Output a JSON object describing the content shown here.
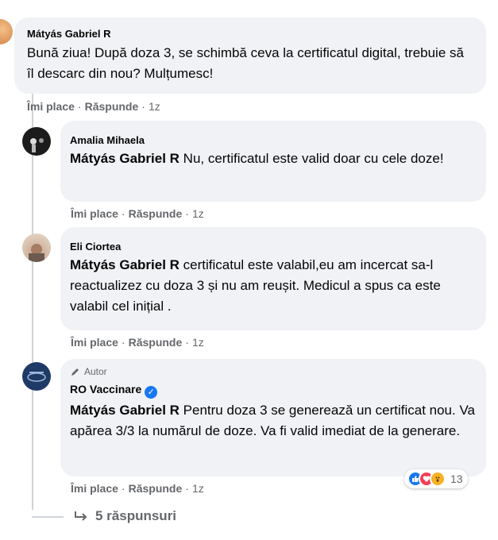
{
  "comments": [
    {
      "author": "Mátyás Gabriel R",
      "text": "Bună ziua! După doza 3, se schimbă ceva la certificatul digital, trebuie să îl descarc din nou? Mulțumesc!",
      "actions": {
        "like": "Îmi place",
        "reply": "Răspunde",
        "time": "1z"
      }
    },
    {
      "author": "Amalia Mihaela",
      "mention": "Mátyás Gabriel R",
      "text": " Nu, certificatul este valid doar cu cele doze!",
      "actions": {
        "like": "Îmi place",
        "reply": "Răspunde",
        "time": "1z"
      }
    },
    {
      "author": "Eli Ciortea",
      "mention": "Mátyás Gabriel R",
      "text": " certificatul este valabil,eu am incercat sa-l reactualizez cu doza 3 și nu am reușit. Medicul a spus ca este valabil cel inițial .",
      "actions": {
        "like": "Îmi place",
        "reply": "Răspunde",
        "time": "1z"
      }
    },
    {
      "author_tag": "Autor",
      "author": "RO Vaccinare",
      "mention": "Mátyás Gabriel R",
      "text": " Pentru doza 3 se generează un certificat nou. Va apărea 3/3 la numărul de doze. Va fi valid imediat de la generare.",
      "actions": {
        "like": "Îmi place",
        "reply": "Răspunde",
        "time": "1z"
      },
      "reactions": {
        "icons": [
          "like-icon",
          "love-icon",
          "wow-icon"
        ],
        "count": "13"
      }
    }
  ],
  "more_replies": {
    "label": "5 răspunsuri",
    "icon": "reply-arrow-icon"
  },
  "colors": {
    "bubble": "#f0f2f5",
    "secondary": "#65676b",
    "verified": "#1877f2",
    "like": "#1877f2",
    "love": "#f33e58",
    "wow": "#f7b125"
  }
}
